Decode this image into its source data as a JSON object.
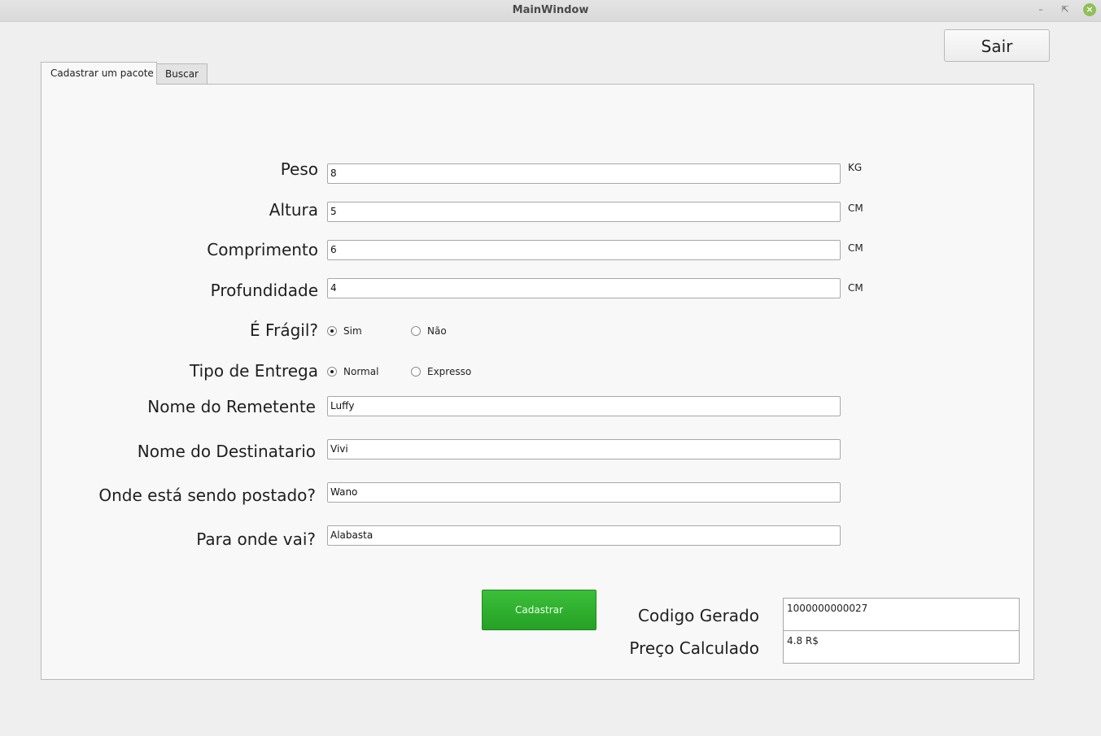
{
  "window": {
    "title": "MainWindow"
  },
  "toolbar": {
    "exit_label": "Sair"
  },
  "tabs": [
    {
      "label": "Cadastrar um pacote"
    },
    {
      "label": "Buscar"
    }
  ],
  "form": {
    "peso": {
      "label": "Peso",
      "value": "8",
      "unit": "KG"
    },
    "altura": {
      "label": "Altura",
      "value": "5",
      "unit": "CM"
    },
    "comprimento": {
      "label": "Comprimento",
      "value": "6",
      "unit": "CM"
    },
    "profundidade": {
      "label": "Profundidade",
      "value": "4",
      "unit": "CM"
    },
    "fragil": {
      "label": "É Frágil?",
      "options": [
        "Sim",
        "Não"
      ],
      "selected": "Sim"
    },
    "entrega": {
      "label": "Tipo de Entrega",
      "options": [
        "Normal",
        "Expresso"
      ],
      "selected": "Normal"
    },
    "remetente": {
      "label": "Nome do Remetente",
      "value": "Luffy"
    },
    "destinatario": {
      "label": "Nome do Destinatario",
      "value": "Vivi"
    },
    "origem": {
      "label": "Onde está sendo postado?",
      "value": "Wano"
    },
    "destino": {
      "label": "Para onde vai?",
      "value": "Alabasta"
    },
    "submit_label": "Cadastrar"
  },
  "result": {
    "codigo": {
      "label": "Codigo Gerado",
      "value": "1000000000027"
    },
    "preco": {
      "label": "Preço Calculado",
      "value": "4.8 R$"
    }
  },
  "colors": {
    "accent": "#2eae2e",
    "background": "#efefef",
    "panel": "#f8f8f8"
  },
  "icons": {
    "minimize": "minimize-icon",
    "maximize": "maximize-icon",
    "close": "close-icon"
  }
}
